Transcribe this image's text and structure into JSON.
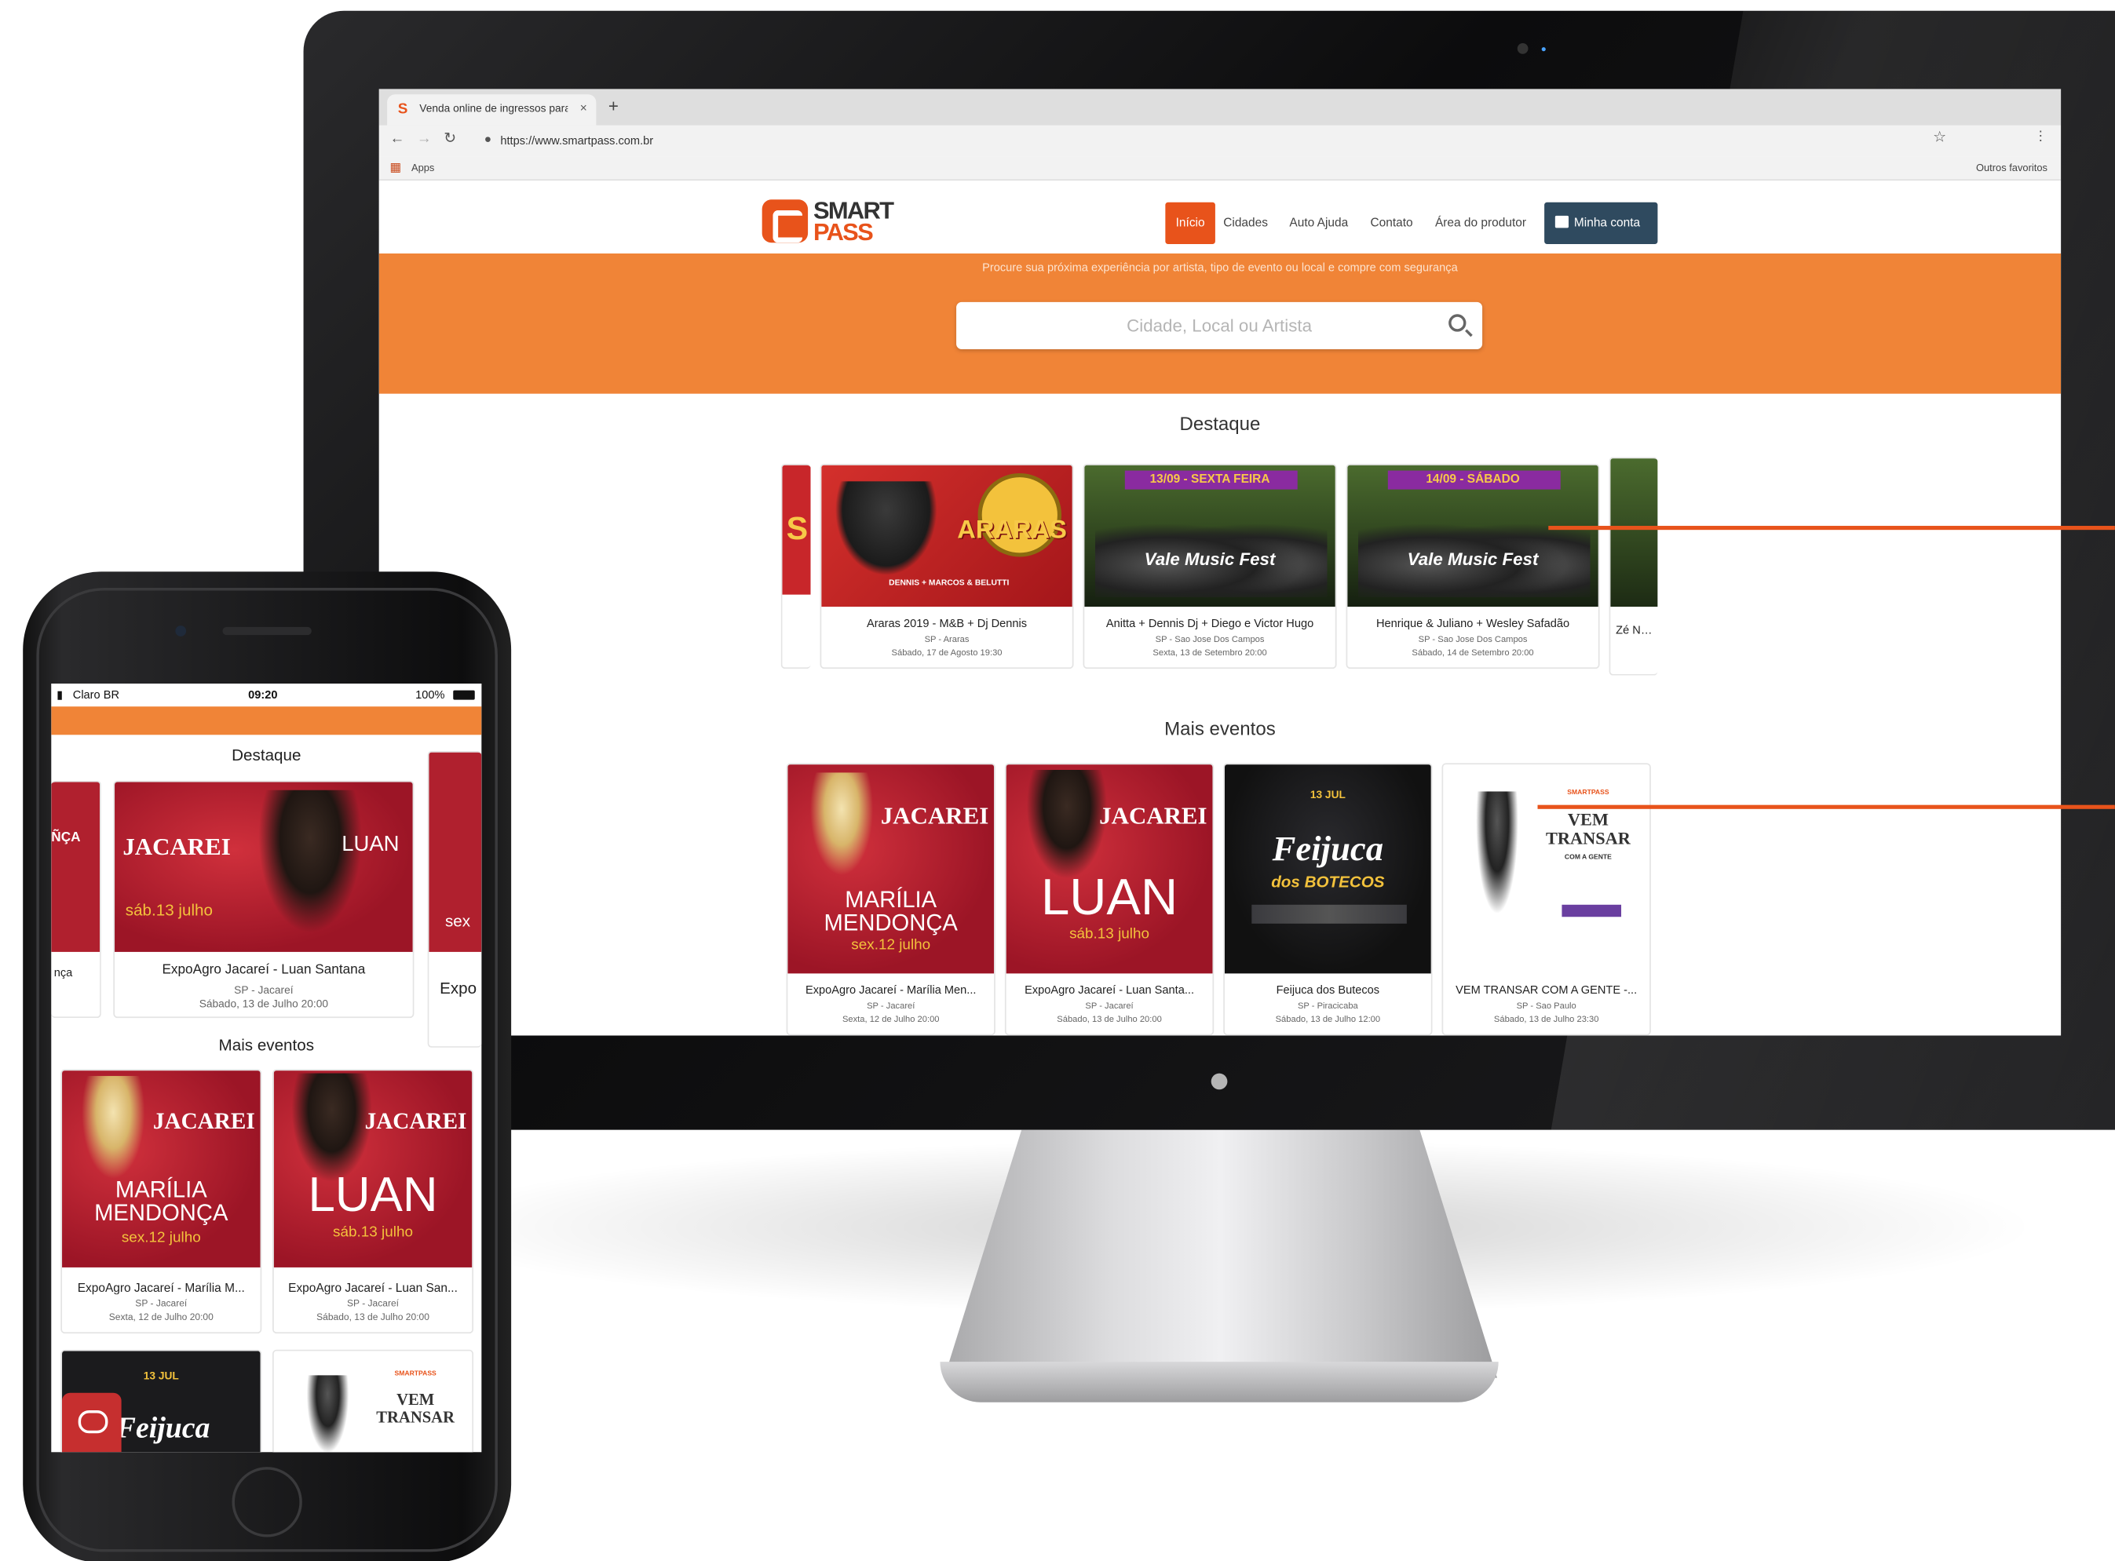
{
  "browser": {
    "tab_title": "Venda online de ingressos para",
    "tab_close": "×",
    "new_tab": "+",
    "url": "https://www.smartpass.com.br",
    "apps_label": "Apps",
    "other_bookmarks": "Outros favoritos"
  },
  "site": {
    "logo_line1": "SMART",
    "logo_line2": "PASS",
    "nav": [
      "Início",
      "Cidades",
      "Auto Ajuda",
      "Contato",
      "Área do produtor"
    ],
    "account_label": "Minha conta",
    "hero_subtitle": "Procure sua próxima experiência por artista, tipo de evento ou local e compre com segurança",
    "search_placeholder": "Cidade, Local ou Artista",
    "featured_title": "Destaque",
    "more_title": "Mais eventos",
    "featured": [
      {
        "title": "Araras 2019 - M&B + Dj Dennis",
        "location": "SP - Araras",
        "date": "Sábado, 17 de Agosto 19:30",
        "banner": "ARARAS",
        "banner_sub": "DENNIS + MARCOS & BELUTTI",
        "color": "#c8262a"
      },
      {
        "title": "Anitta + Dennis Dj + Diego e Victor Hugo",
        "location": "SP - Sao Jose Dos Campos",
        "date": "Sexta, 13 de Setembro 20:00",
        "banner": "13/09 - SEXTA FEIRA",
        "banner_sub": "Vale Music Fest",
        "color": "#3a5a2a"
      },
      {
        "title": "Henrique & Juliano + Wesley Safadão",
        "location": "SP - Sao Jose Dos Campos",
        "date": "Sábado, 14 de Setembro 20:00",
        "banner": "14/09 - SÁBADO",
        "banner_sub": "Vale Music Fest",
        "color": "#3a5a2a"
      },
      {
        "title": "Zé Neto",
        "location": "",
        "date": "",
        "banner": "",
        "banner_sub": "",
        "color": "#4b6b2e"
      }
    ],
    "featured_partial_left": {
      "banner": "S",
      "color": "#c8262a"
    },
    "more": [
      {
        "title": "ExpoAgro Jacareí - Marília Men...",
        "location": "SP - Jacareí",
        "date": "Sexta, 12 de Julho 20:00",
        "banner": "MARÍLIA MENDONÇA",
        "banner_sub": "sex.12 julho",
        "brand": "JACAREI",
        "color": "#b0202e"
      },
      {
        "title": "ExpoAgro Jacareí - Luan Santa...",
        "location": "SP - Jacareí",
        "date": "Sábado, 13 de Julho 20:00",
        "banner": "LUAN",
        "banner_sub": "sáb.13 julho",
        "brand": "JACAREI",
        "color": "#b0202e"
      },
      {
        "title": "Feijuca dos Butecos",
        "location": "SP - Piracicaba",
        "date": "Sábado, 13 de Julho 12:00",
        "banner": "Feijuca",
        "banner_sub": "dos BOTECOS",
        "brand": "13 JUL",
        "color": "#1b1b1d"
      },
      {
        "title": "VEM TRANSAR COM A GENTE -...",
        "location": "SP - Sao Paulo",
        "date": "Sábado, 13 de Julho 23:30",
        "banner": "VEM TRANSAR",
        "banner_sub": "COM A GENTE",
        "brand": "SMARTPASS",
        "color": "#ffffff"
      }
    ]
  },
  "phone": {
    "carrier": "Claro BR",
    "time": "09:20",
    "battery": "100%",
    "featured_title": "Destaque",
    "more_title": "Mais eventos",
    "featured_main": {
      "title": "ExpoAgro Jacareí - Luan Santana",
      "location": "SP - Jacareí",
      "date": "Sábado, 13 de Julho 20:00",
      "banner": "LUAN",
      "banner_sub": "sáb.13 julho",
      "brand": "JACAREI"
    },
    "featured_left_title": "nça",
    "featured_left_banner": "ÑÇA",
    "featured_right_title": "Expo",
    "featured_right_banner": "sex",
    "more": [
      {
        "title": "ExpoAgro Jacareí - Marília M...",
        "location": "SP - Jacareí",
        "date": "Sexta, 12 de Julho 20:00",
        "banner": "MARÍLIA MENDONÇA",
        "banner_sub": "sex.12 julho",
        "brand": "JACAREI"
      },
      {
        "title": "ExpoAgro Jacareí - Luan San...",
        "location": "SP - Jacareí",
        "date": "Sábado, 13 de Julho 20:00",
        "banner": "LUAN",
        "banner_sub": "sáb.13 julho",
        "brand": "JACAREI"
      }
    ],
    "more_bottom": [
      {
        "banner": "Feijuca",
        "brand": "13 JUL"
      },
      {
        "banner": "VEM TRANSAR",
        "brand": "SMARTPASS"
      }
    ]
  },
  "colors": {
    "orange": "#f08437",
    "accent": "#e8531b",
    "account": "#2f4a5f",
    "jacarei_red": "#b0202e"
  }
}
